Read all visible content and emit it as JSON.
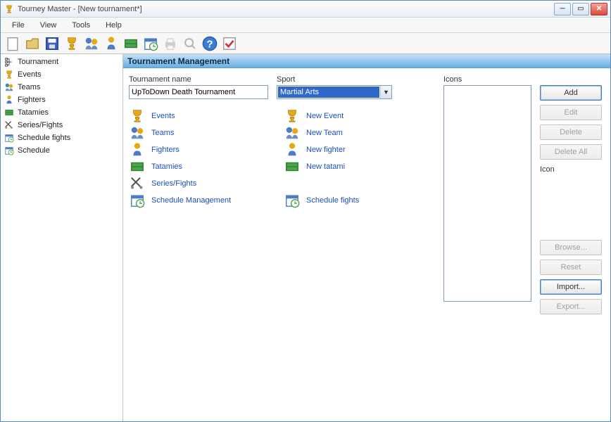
{
  "window": {
    "title": "Tourney Master - [New tournament*]"
  },
  "menu": {
    "file": "File",
    "view": "View",
    "tools": "Tools",
    "help": "Help"
  },
  "sidebar": {
    "items": [
      {
        "label": "Tournament",
        "icon": "tournament"
      },
      {
        "label": "Events",
        "icon": "trophy"
      },
      {
        "label": "Teams",
        "icon": "teams"
      },
      {
        "label": "Fighters",
        "icon": "fighter"
      },
      {
        "label": "Tatamies",
        "icon": "tatami"
      },
      {
        "label": "Series/Fights",
        "icon": "swords"
      },
      {
        "label": "Schedule fights",
        "icon": "schedule"
      },
      {
        "label": "Schedule",
        "icon": "schedule"
      }
    ]
  },
  "header": {
    "title": "Tournament Management"
  },
  "form": {
    "name_label": "Tournament name",
    "name_value": "UpToDown Death Tournament",
    "sport_label": "Sport",
    "sport_value": "Martial Arts",
    "icons_label": "Icons",
    "icon_label": "Icon"
  },
  "links": {
    "col1": [
      {
        "label": "Events",
        "icon": "trophy"
      },
      {
        "label": "Teams",
        "icon": "teams"
      },
      {
        "label": "Fighters",
        "icon": "fighter"
      },
      {
        "label": "Tatamies",
        "icon": "tatami"
      },
      {
        "label": "Series/Fights",
        "icon": "swords"
      },
      {
        "label": "Schedule Management",
        "icon": "schedule"
      }
    ],
    "col2": [
      {
        "label": "New Event",
        "icon": "trophy"
      },
      {
        "label": "New Team",
        "icon": "teams"
      },
      {
        "label": "New fighter",
        "icon": "fighter"
      },
      {
        "label": "New tatami",
        "icon": "tatami"
      },
      {
        "label": "",
        "icon": ""
      },
      {
        "label": "Schedule fights",
        "icon": "schedule"
      }
    ]
  },
  "buttons": {
    "add": "Add",
    "edit": "Edit",
    "delete": "Delete",
    "delete_all": "Delete All",
    "browse": "Browse...",
    "reset": "Reset",
    "import": "Import...",
    "export": "Export..."
  }
}
